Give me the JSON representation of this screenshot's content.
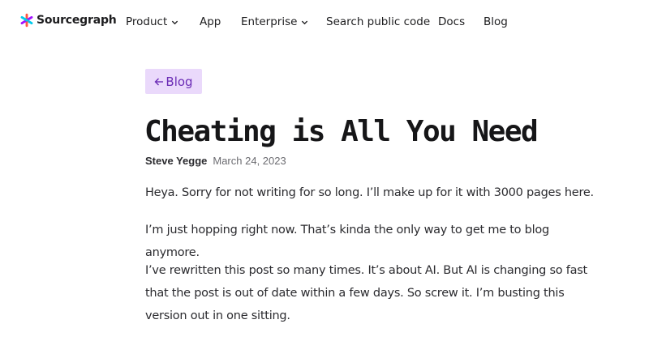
{
  "nav": {
    "logo_text": "Sourcegraph",
    "items": [
      {
        "label": "Product",
        "has_dropdown": true
      },
      {
        "label": "App",
        "has_dropdown": false
      },
      {
        "label": "Enterprise",
        "has_dropdown": true
      },
      {
        "label": "Search public code",
        "has_dropdown": false
      },
      {
        "label": "Docs",
        "has_dropdown": false
      },
      {
        "label": "Blog",
        "has_dropdown": false
      }
    ]
  },
  "back_link": {
    "label": "Blog",
    "icon": "arrow-left-icon"
  },
  "article": {
    "title": "Cheating is All You Need",
    "author": "Steve Yegge",
    "date": "March 24, 2023",
    "paragraphs": [
      "Heya. Sorry for not writing for so long. I’ll make up for it with 3000 pages here.",
      "I’m just hopping right now. That’s kinda the only way to get me to blog anymore.",
      "I’ve rewritten this post so many times. It’s about AI. But AI is changing so fast that the post is out of date within a few days. So screw it. I’m busting this version out in one sitting."
    ]
  },
  "colors": {
    "back_link_bg": "#ead9fb",
    "back_link_text": "#6a2bb5",
    "logo_orange": "#ff5543",
    "logo_purple": "#a112ff",
    "logo_blue": "#00cbec"
  }
}
